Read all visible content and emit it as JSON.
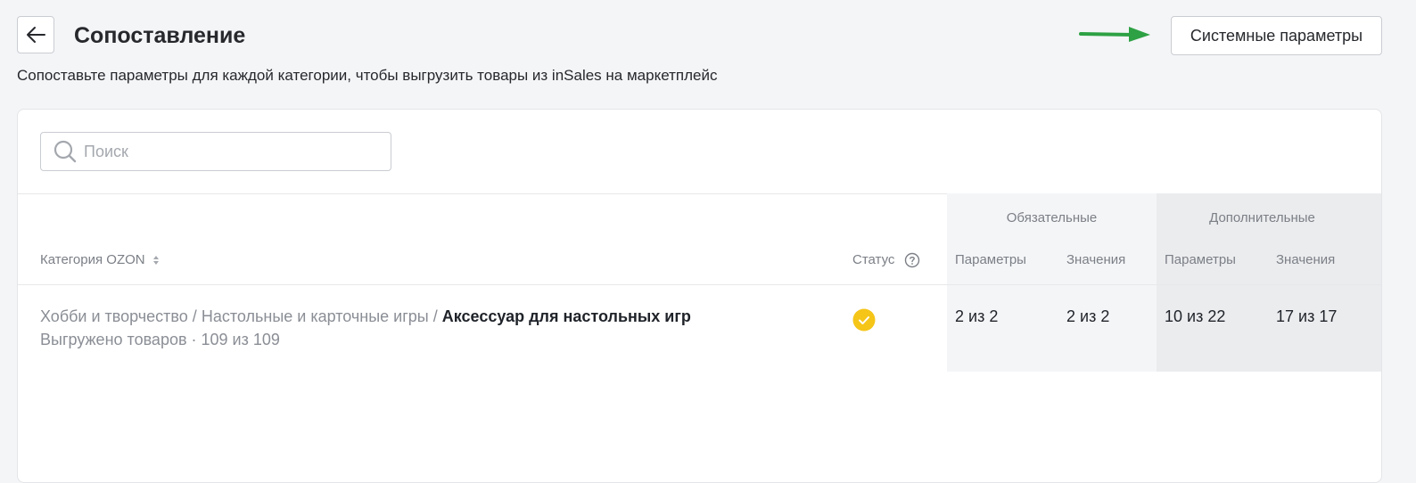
{
  "header": {
    "title": "Сопоставление",
    "system_button": "Системные параметры",
    "subtitle": "Сопоставьте параметры для каждой категории, чтобы выгрузить товары из inSales на маркетплейс"
  },
  "search": {
    "placeholder": "Поиск",
    "value": ""
  },
  "table": {
    "groups": {
      "required": "Обязательные",
      "additional": "Дополнительные"
    },
    "columns": {
      "category": "Категория OZON",
      "status": "Статус",
      "req_params": "Параметры",
      "req_values": "Значения",
      "add_params": "Параметры",
      "add_values": "Значения"
    },
    "rows": [
      {
        "path_1": "Хобби и творчество",
        "sep": "/",
        "path_2": "Настольные и карточные игры",
        "leaf": "Аксессуар для настольных игр",
        "uploaded": "Выгружено товаров · 109 из 109",
        "status": "check-circle-icon",
        "req_params": "2 из 2",
        "req_values": "2 из 2",
        "add_params": "10 из 22",
        "add_values": "17 из 17"
      }
    ]
  },
  "colors": {
    "page_bg": "#f4f5f7",
    "status_ok": "#f5c518",
    "annotation_arrow": "#2da144",
    "required_bg": "#f4f5f7",
    "additional_bg": "#ebecee"
  },
  "icons": [
    "arrow-left-icon",
    "search-icon",
    "sort-icon",
    "help-icon",
    "check-circle-icon",
    "annotation-arrow-icon"
  ]
}
